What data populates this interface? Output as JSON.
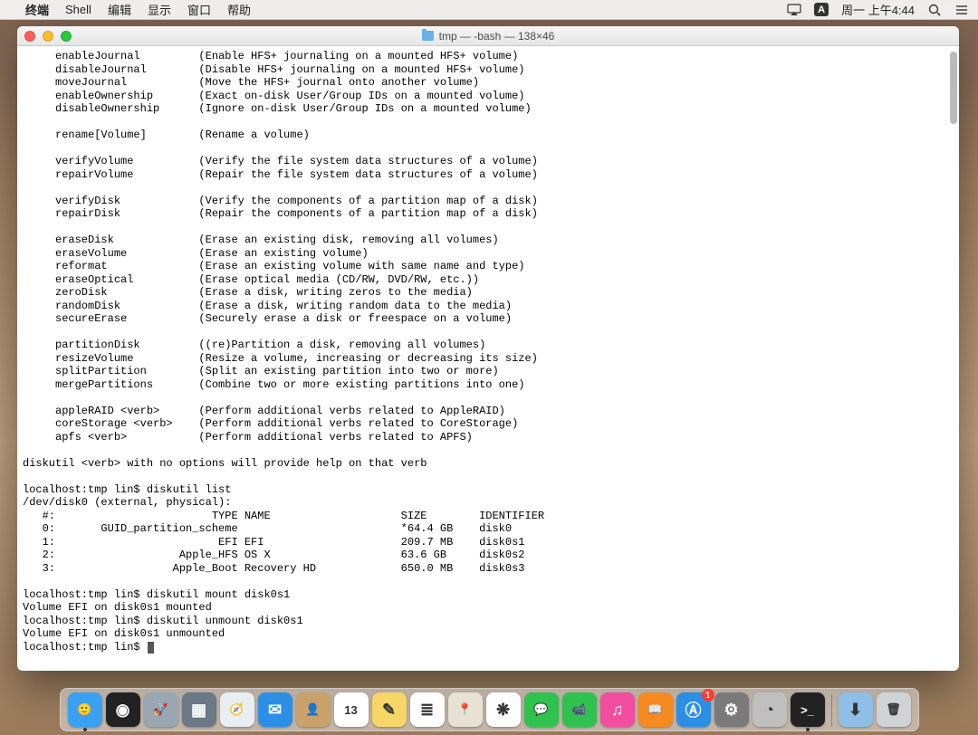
{
  "menubar": {
    "apple": "",
    "app": "终端",
    "menus": [
      "Shell",
      "编辑",
      "显示",
      "窗口",
      "帮助"
    ],
    "input_badge": "A",
    "clock": "周一 上午4:44"
  },
  "window": {
    "title": "tmp — -bash — 138×46"
  },
  "terminal": {
    "help_verbs": [
      {
        "v": "enableJournal",
        "d": "(Enable HFS+ journaling on a mounted HFS+ volume)"
      },
      {
        "v": "disableJournal",
        "d": "(Disable HFS+ journaling on a mounted HFS+ volume)"
      },
      {
        "v": "moveJournal",
        "d": "(Move the HFS+ journal onto another volume)"
      },
      {
        "v": "enableOwnership",
        "d": "(Exact on-disk User/Group IDs on a mounted volume)"
      },
      {
        "v": "disableOwnership",
        "d": "(Ignore on-disk User/Group IDs on a mounted volume)"
      },
      {
        "v": "",
        "d": ""
      },
      {
        "v": "rename[Volume]",
        "d": "(Rename a volume)"
      },
      {
        "v": "",
        "d": ""
      },
      {
        "v": "verifyVolume",
        "d": "(Verify the file system data structures of a volume)"
      },
      {
        "v": "repairVolume",
        "d": "(Repair the file system data structures of a volume)"
      },
      {
        "v": "",
        "d": ""
      },
      {
        "v": "verifyDisk",
        "d": "(Verify the components of a partition map of a disk)"
      },
      {
        "v": "repairDisk",
        "d": "(Repair the components of a partition map of a disk)"
      },
      {
        "v": "",
        "d": ""
      },
      {
        "v": "eraseDisk",
        "d": "(Erase an existing disk, removing all volumes)"
      },
      {
        "v": "eraseVolume",
        "d": "(Erase an existing volume)"
      },
      {
        "v": "reformat",
        "d": "(Erase an existing volume with same name and type)"
      },
      {
        "v": "eraseOptical",
        "d": "(Erase optical media (CD/RW, DVD/RW, etc.))"
      },
      {
        "v": "zeroDisk",
        "d": "(Erase a disk, writing zeros to the media)"
      },
      {
        "v": "randomDisk",
        "d": "(Erase a disk, writing random data to the media)"
      },
      {
        "v": "secureErase",
        "d": "(Securely erase a disk or freespace on a volume)"
      },
      {
        "v": "",
        "d": ""
      },
      {
        "v": "partitionDisk",
        "d": "((re)Partition a disk, removing all volumes)"
      },
      {
        "v": "resizeVolume",
        "d": "(Resize a volume, increasing or decreasing its size)"
      },
      {
        "v": "splitPartition",
        "d": "(Split an existing partition into two or more)"
      },
      {
        "v": "mergePartitions",
        "d": "(Combine two or more existing partitions into one)"
      },
      {
        "v": "",
        "d": ""
      },
      {
        "v": "appleRAID <verb>",
        "d": "(Perform additional verbs related to AppleRAID)"
      },
      {
        "v": "coreStorage <verb>",
        "d": "(Perform additional verbs related to CoreStorage)"
      },
      {
        "v": "apfs <verb>",
        "d": "(Perform additional verbs related to APFS)"
      }
    ],
    "help_footer": "diskutil <verb> with no options will provide help on that verb",
    "prompt": "localhost:tmp lin$ ",
    "cmd_list": "diskutil list",
    "list_header_device": "/dev/disk0 (external, physical):",
    "list_columns": {
      "idx": "#:",
      "type": "TYPE",
      "name": "NAME",
      "size": "SIZE",
      "ident": "IDENTIFIER"
    },
    "list_rows": [
      {
        "idx": "0:",
        "type": "GUID_partition_scheme",
        "name": "",
        "size": "*64.4 GB",
        "ident": "disk0"
      },
      {
        "idx": "1:",
        "type": "EFI",
        "name": "EFI",
        "size": "209.7 MB",
        "ident": "disk0s1"
      },
      {
        "idx": "2:",
        "type": "Apple_HFS",
        "name": "OS X",
        "size": "63.6 GB",
        "ident": "disk0s2"
      },
      {
        "idx": "3:",
        "type": "Apple_Boot",
        "name": "Recovery HD",
        "size": "650.0 MB",
        "ident": "disk0s3"
      }
    ],
    "cmd_mount": "diskutil mount disk0s1",
    "resp_mount": "Volume EFI on disk0s1 mounted",
    "cmd_unmount": "diskutil unmount disk0s1",
    "resp_unmount": "Volume EFI on disk0s1 unmounted"
  },
  "dock": {
    "apps": [
      {
        "name": "finder",
        "bg": "#3aa0f2",
        "glyph": "🙂",
        "running": true
      },
      {
        "name": "siri",
        "bg": "#222",
        "glyph": "◉"
      },
      {
        "name": "launchpad",
        "bg": "#9aa6b2",
        "glyph": "🚀"
      },
      {
        "name": "mission",
        "bg": "#6b7885",
        "glyph": "▦"
      },
      {
        "name": "safari",
        "bg": "#e9eef2",
        "glyph": "🧭"
      },
      {
        "name": "mail",
        "bg": "#2b8fe6",
        "glyph": "✉"
      },
      {
        "name": "contacts",
        "bg": "#c9a16b",
        "glyph": "👤"
      },
      {
        "name": "calendar",
        "bg": "#fff",
        "glyph": "13"
      },
      {
        "name": "notes",
        "bg": "#f6d667",
        "glyph": "✎"
      },
      {
        "name": "reminders",
        "bg": "#fff",
        "glyph": "≣"
      },
      {
        "name": "maps",
        "bg": "#e7e2d4",
        "glyph": "📍"
      },
      {
        "name": "photos",
        "bg": "#fff",
        "glyph": "❋"
      },
      {
        "name": "messages",
        "bg": "#2fc24e",
        "glyph": "💬"
      },
      {
        "name": "facetime",
        "bg": "#2fc24e",
        "glyph": "📹"
      },
      {
        "name": "itunes",
        "bg": "#f24ea0",
        "glyph": "♫"
      },
      {
        "name": "ibooks",
        "bg": "#f58a1f",
        "glyph": "📖"
      },
      {
        "name": "appstore",
        "bg": "#2b8fe6",
        "glyph": "Ⓐ",
        "badge": "1"
      },
      {
        "name": "preferences",
        "bg": "#7a7a7a",
        "glyph": "⚙"
      },
      {
        "name": "diskutility",
        "bg": "#bfbfbf",
        "glyph": "◔"
      },
      {
        "name": "terminal",
        "bg": "#222",
        "glyph": ">_",
        "running": true
      }
    ],
    "right": [
      {
        "name": "downloads",
        "bg": "#8fbfe6",
        "glyph": "⬇"
      },
      {
        "name": "trash",
        "bg": "#d0d3d6",
        "glyph": "🗑"
      }
    ]
  }
}
